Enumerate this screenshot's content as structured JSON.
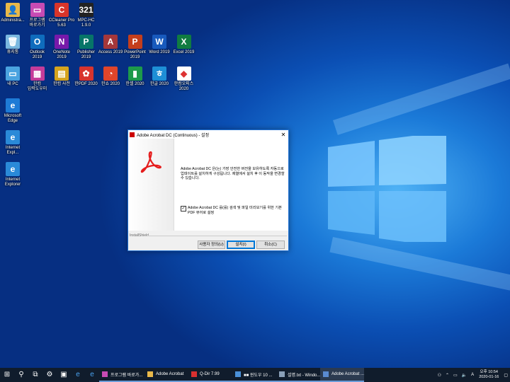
{
  "desktop": {
    "icons": [
      {
        "label": "Administra...",
        "color": "#e8b84a",
        "glyph": "👤",
        "icon": "user-folder-icon"
      },
      {
        "label": "프로그램\n바로가기",
        "color": "#c74bb4",
        "glyph": "▭",
        "icon": "tv-shortcut-icon"
      },
      {
        "label": "CCleaner Pro\n5.63",
        "color": "#d9352a",
        "glyph": "C",
        "icon": "ccleaner-icon"
      },
      {
        "label": "MPC-HC\n1.9.0",
        "color": "#222222",
        "glyph": "321",
        "icon": "mpc-hc-icon"
      },
      {
        "label": "휴지통",
        "color": "#7ab8e0",
        "glyph": "🗑",
        "icon": "recycle-bin-icon"
      },
      {
        "label": "Outlook\n2019",
        "color": "#0f6cbd",
        "glyph": "O",
        "icon": "outlook-icon"
      },
      {
        "label": "OneNote\n2019",
        "color": "#7719aa",
        "glyph": "N",
        "icon": "onenote-icon"
      },
      {
        "label": "Publisher\n2019",
        "color": "#077568",
        "glyph": "P",
        "icon": "publisher-icon"
      },
      {
        "label": "Access 2019",
        "color": "#a4373a",
        "glyph": "A",
        "icon": "access-icon"
      },
      {
        "label": "PowerPoint\n2019",
        "color": "#c43e1c",
        "glyph": "P",
        "icon": "powerpoint-icon"
      },
      {
        "label": "Word 2019",
        "color": "#185abd",
        "glyph": "W",
        "icon": "word-icon"
      },
      {
        "label": "Excel 2019",
        "color": "#107c41",
        "glyph": "X",
        "icon": "excel-icon"
      },
      {
        "label": "내 PC",
        "color": "#4aa3e0",
        "glyph": "▭",
        "icon": "this-pc-icon"
      },
      {
        "label": "한컴\n입력도우미",
        "color": "#c43c9a",
        "glyph": "▦",
        "icon": "hancom-input-icon"
      },
      {
        "label": "한컴 사전",
        "color": "#d6a41e",
        "glyph": "▤",
        "icon": "hancom-dict-icon"
      },
      {
        "label": "한PDF 2020",
        "color": "#d8342e",
        "glyph": "✿",
        "icon": "hanpdf-icon"
      },
      {
        "label": "한쇼 2020",
        "color": "#e0452a",
        "glyph": "◔",
        "icon": "hanshow-icon"
      },
      {
        "label": "한셀 2020",
        "color": "#1d9a4a",
        "glyph": "▮",
        "icon": "hancell-icon"
      },
      {
        "label": "한글 2020",
        "color": "#1e8fd6",
        "glyph": "ㅎ",
        "icon": "hangul-icon"
      },
      {
        "label": "한컴오피스\n2020",
        "color": "#ffffff",
        "glyph": "◆",
        "icon": "hancom-office-icon"
      },
      {
        "label": "Microsoft\nEdge",
        "color": "#1e7bd6",
        "glyph": "e",
        "icon": "edge-icon"
      },
      {
        "label": "Internet\nExpl...",
        "color": "#2a8ad8",
        "glyph": "e",
        "icon": "internet-explorer-icon"
      },
      {
        "label": "Internet\nExplorer",
        "color": "#2a8ad8",
        "glyph": "e",
        "icon": "internet-explorer-icon"
      }
    ]
  },
  "dialog": {
    "title": "Adobe Acrobat DC (Continuous) - 설정",
    "close": "✕",
    "message": "Adobe Acrobat DC 은(는) 가장 안전한 버전을 보유하도록 자동으로 업데이트를 설치하게 구성됩니다. 제열에서 설치 후 이 동작을 변경할 수 있습니다.",
    "checkbox_checked": "✓",
    "checkbox_label": "Adobe Acrobat DC 를(를) 검색 및 파일 미리보기를 위한 기본 PDF 뷰어로 설정",
    "footer_label": "InstallShield",
    "buttons": {
      "custom": "사용자 정의(U)",
      "install": "설치(I)",
      "cancel": "취소(C)"
    }
  },
  "taskbar": {
    "tasks": [
      {
        "label": "프로그램 바로가...",
        "color": "#c74bb4"
      },
      {
        "label": "Adobe Acrobat",
        "color": "#e8b84a"
      },
      {
        "label": "Q-Dir 7.99",
        "color": "#d83030"
      },
      {
        "label": "■■ 윈도우 10 ...",
        "color": "#4a90d8"
      },
      {
        "label": "설명.txt - Windo...",
        "color": "#8aa0b8"
      },
      {
        "label": "Adobe Acrobat ...",
        "color": "#5a8ad0"
      }
    ],
    "clock_time": "오후 10:54",
    "clock_date": "2020-01-16"
  }
}
